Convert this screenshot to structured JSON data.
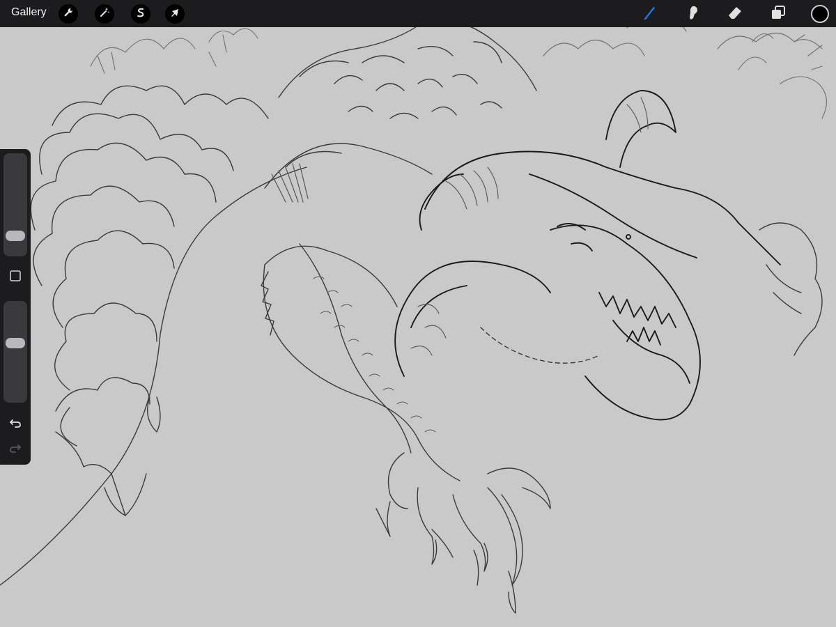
{
  "app": {
    "gallery_label": "Gallery"
  },
  "toolbar": {
    "left_tools": [
      {
        "name": "actions",
        "icon": "wrench-icon"
      },
      {
        "name": "adjustments",
        "icon": "magic-wand-icon"
      },
      {
        "name": "selection",
        "icon": "selection-s-icon"
      },
      {
        "name": "transform",
        "icon": "arrow-cursor-icon"
      }
    ],
    "right_tools": [
      {
        "name": "brush",
        "icon": "brush-icon",
        "active": true
      },
      {
        "name": "smudge",
        "icon": "smudge-icon",
        "active": false
      },
      {
        "name": "eraser",
        "icon": "eraser-icon",
        "active": false
      },
      {
        "name": "layers",
        "icon": "layers-icon",
        "active": false
      }
    ],
    "current_color": "#000000",
    "active_color": "#1e7cf2"
  },
  "sidebar": {
    "brush_size_level": 0.15,
    "opacity_level": 0.6,
    "modify_button_icon": "square-icon",
    "undo_icon": "undo-icon",
    "redo_icon": "redo-icon"
  },
  "canvas": {
    "background": "#c9c9c9",
    "subject": "dragon-sketch"
  }
}
